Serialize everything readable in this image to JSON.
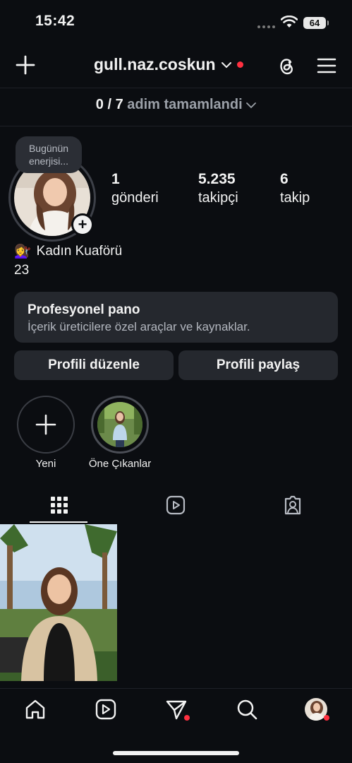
{
  "status": {
    "time": "15:42",
    "battery": "64"
  },
  "header": {
    "username": "gull.naz.coskun"
  },
  "progress": {
    "count": "0 / 7",
    "label": "adim tamamlandi"
  },
  "note": {
    "text": "Bugünün enerjisi..."
  },
  "stats": [
    {
      "value": "1",
      "label": "gönderi"
    },
    {
      "value": "5.235",
      "label": "takipçi"
    },
    {
      "value": "6",
      "label": "takip"
    }
  ],
  "bio": {
    "emoji": "💇‍♀️",
    "category": "Kadın Kuaförü",
    "line": "23"
  },
  "pro": {
    "title": "Profesyonel pano",
    "subtitle": "İçerik üreticilere özel araçlar ve kaynaklar."
  },
  "buttons": {
    "edit": "Profili düzenle",
    "share": "Profili paylaş"
  },
  "highlights": [
    {
      "label": "Yeni"
    },
    {
      "label": "Öne Çıkanlar"
    }
  ],
  "colors": {
    "background": "#0b0d11",
    "accent_dot": "#ff3040",
    "card": "#25282e"
  },
  "icons": {
    "header": [
      "plus-icon",
      "chevron-down-icon",
      "threads-icon",
      "hamburger-menu-icon"
    ],
    "tabs": [
      "grid-icon",
      "reels-icon",
      "tagged-icon"
    ],
    "nav": [
      "home-icon",
      "reels-icon",
      "direct-send-icon",
      "search-icon",
      "profile-avatar"
    ]
  }
}
